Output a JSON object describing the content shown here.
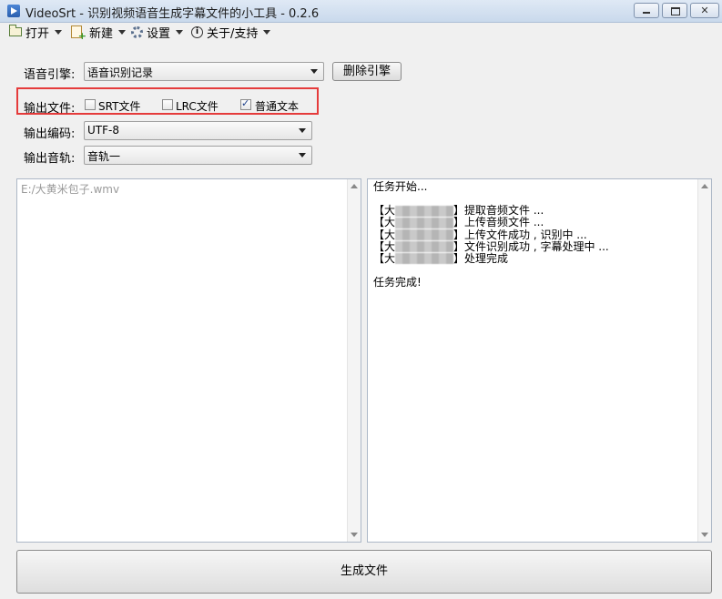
{
  "window": {
    "title": "VideoSrt - 识别视频语音生成字幕文件的小工具 - 0.2.6",
    "controls": {
      "minimize": "",
      "maximize": "",
      "close": "✕"
    }
  },
  "menu": [
    {
      "label": "打开",
      "icon": "folder-open-icon"
    },
    {
      "label": "新建",
      "icon": "new-file-icon"
    },
    {
      "label": "设置",
      "icon": "gear-icon"
    },
    {
      "label": "关于/支持",
      "icon": "info-icon"
    }
  ],
  "engine": {
    "label": "语音引擎:",
    "selected": "语音识别记录",
    "delete_label": "删除引擎"
  },
  "output_file": {
    "label": "输出文件:",
    "options": [
      {
        "label": "SRT文件",
        "checked": false
      },
      {
        "label": "LRC文件",
        "checked": false
      },
      {
        "label": "普通文本",
        "checked": true
      }
    ]
  },
  "output_encoding": {
    "label": "输出编码:",
    "selected": "UTF-8"
  },
  "output_track": {
    "label": "输出音轨:",
    "selected": "音轨一"
  },
  "left_panel": {
    "placeholder": "E:/大黄米包子.wmv"
  },
  "log": {
    "start": "任务开始...",
    "lines": [
      {
        "prefix": "【大",
        "suffix": "】提取音频文件 ..."
      },
      {
        "prefix": "【大",
        "suffix": "】上传音频文件 ..."
      },
      {
        "prefix": "【大",
        "suffix": "】上传文件成功 , 识别中 ..."
      },
      {
        "prefix": "【大",
        "suffix": "】文件识别成功 , 字幕处理中 ..."
      },
      {
        "prefix": "【大",
        "suffix": "】处理完成"
      }
    ],
    "end": "任务完成!"
  },
  "generate": {
    "label": "生成文件"
  }
}
